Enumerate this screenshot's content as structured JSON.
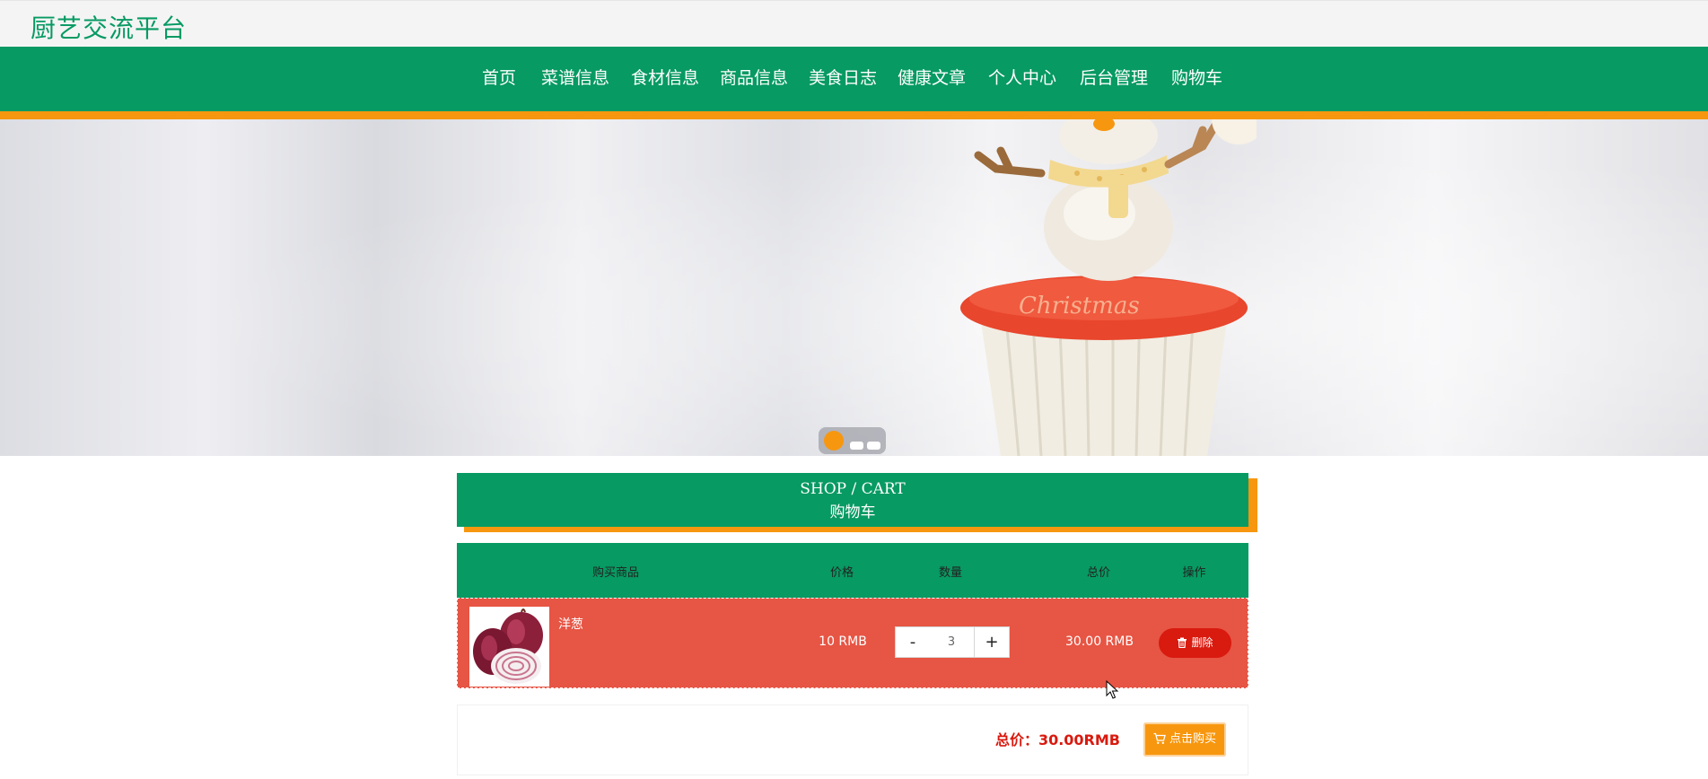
{
  "header": {
    "site_title": "厨艺交流平台"
  },
  "nav": {
    "items": [
      {
        "label": "首页"
      },
      {
        "label": "菜谱信息"
      },
      {
        "label": "食材信息"
      },
      {
        "label": "商品信息"
      },
      {
        "label": "美食日志"
      },
      {
        "label": "健康文章"
      },
      {
        "label": "个人中心"
      },
      {
        "label": "后台管理"
      },
      {
        "label": "购物车"
      }
    ]
  },
  "banner": {
    "slide_count": 3,
    "active_slide": 1
  },
  "section": {
    "title_en": "SHOP / CART",
    "title_cn": "购物车"
  },
  "cart": {
    "headers": {
      "product": "购买商品",
      "price": "价格",
      "quantity": "数量",
      "total": "总价",
      "action": "操作"
    },
    "items": [
      {
        "name": "洋葱",
        "price": "10 RMB",
        "quantity": "3",
        "decrement_label": "-",
        "increment_label": "+",
        "total": "30.00 RMB",
        "delete_label": "删除"
      }
    ]
  },
  "summary": {
    "total_text": "总价：30.00RMB",
    "buy_label": "点击购买"
  },
  "colors": {
    "primary_green": "#079a63",
    "accent_orange": "#f7970f",
    "row_red": "#e75544",
    "danger_red": "#d91a0f"
  }
}
